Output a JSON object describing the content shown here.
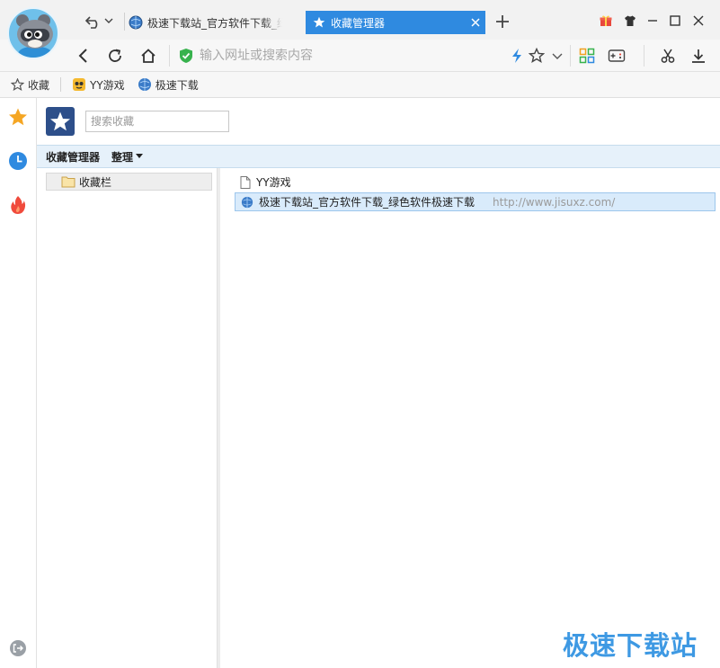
{
  "tabs": [
    {
      "title": "极速下载站_官方软件下载_绿色软件极速下载",
      "active": false
    },
    {
      "title": "收藏管理器",
      "active": true
    }
  ],
  "address": {
    "placeholder": "输入网址或搜索内容",
    "value": ""
  },
  "bookmarks_bar": [
    {
      "label": "收藏",
      "icon": "star-outline-icon"
    },
    {
      "label": "YY游戏",
      "icon": "yy-games-icon"
    },
    {
      "label": "极速下载",
      "icon": "globe-icon"
    }
  ],
  "manager": {
    "search_placeholder": "搜索收藏",
    "toolbar_title": "收藏管理器",
    "toolbar_menu": "整理",
    "tree": [
      {
        "label": "收藏栏",
        "icon": "folder-icon"
      }
    ],
    "items": [
      {
        "title": "YY游戏",
        "url": "",
        "icon": "document-icon",
        "selected": false
      },
      {
        "title": "极速下载站_官方软件下载_绿色软件极速下载",
        "url": "http://www.jisuxz.com/",
        "icon": "globe-icon",
        "selected": true
      }
    ]
  },
  "watermark": "极速下载站",
  "colors": {
    "accent": "#2f8ae0",
    "toolbar_bg": "#e6f1fa",
    "selection_bg": "#d9ebfb",
    "star": "#f5a623",
    "history": "#2f8ae0",
    "hot": "#f04a3c"
  }
}
